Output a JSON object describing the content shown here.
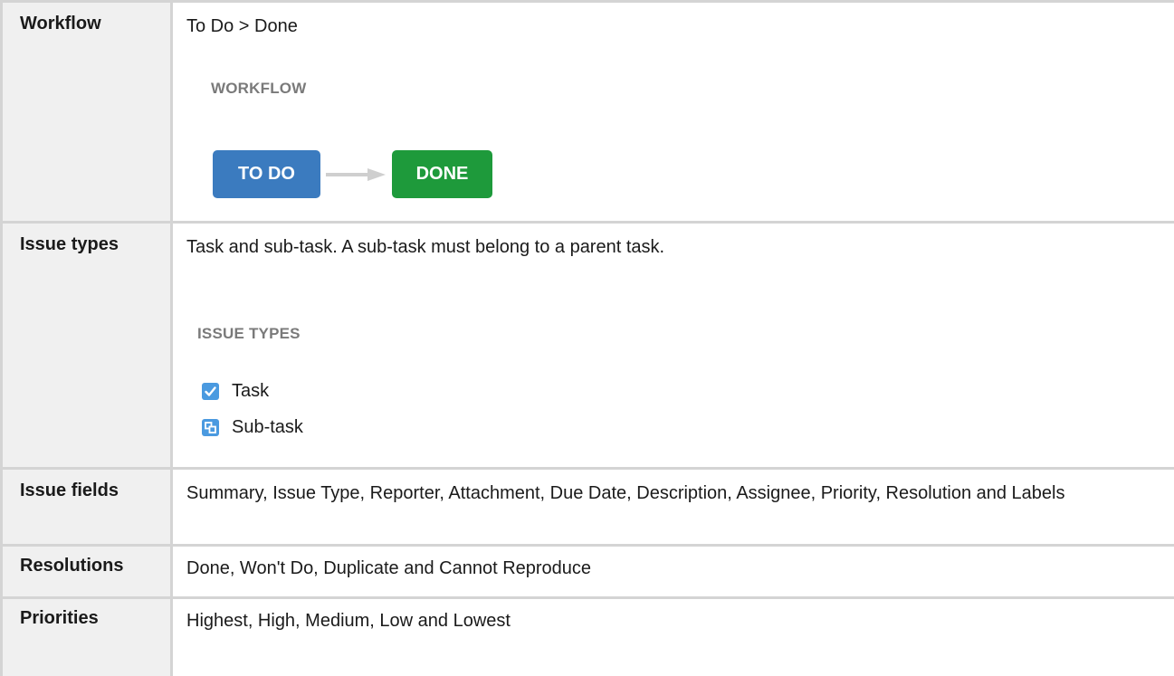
{
  "rows": {
    "workflow": {
      "header": "Workflow",
      "text": "To Do > Done",
      "section_heading": "WORKFLOW",
      "statuses": [
        {
          "label": "TO DO",
          "color": "#3b7bbf"
        },
        {
          "label": "DONE",
          "color": "#1e9a3b"
        }
      ]
    },
    "issue_types": {
      "header": "Issue types",
      "text": "Task and sub-task. A sub-task must belong to a parent task.",
      "section_heading": "ISSUE TYPES",
      "items": [
        {
          "label": "Task",
          "icon": "checkbox-task-icon"
        },
        {
          "label": "Sub-task",
          "icon": "subtask-icon"
        }
      ]
    },
    "issue_fields": {
      "header": "Issue fields",
      "text": "Summary, Issue Type, Reporter, Attachment, Due Date, Description, Assignee, Priority, Resolution and Labels"
    },
    "resolutions": {
      "header": "Resolutions",
      "text": "Done, Won't Do, Duplicate and Cannot Reproduce"
    },
    "priorities": {
      "header": "Priorities",
      "text": "Highest, High, Medium, Low and Lowest"
    }
  }
}
